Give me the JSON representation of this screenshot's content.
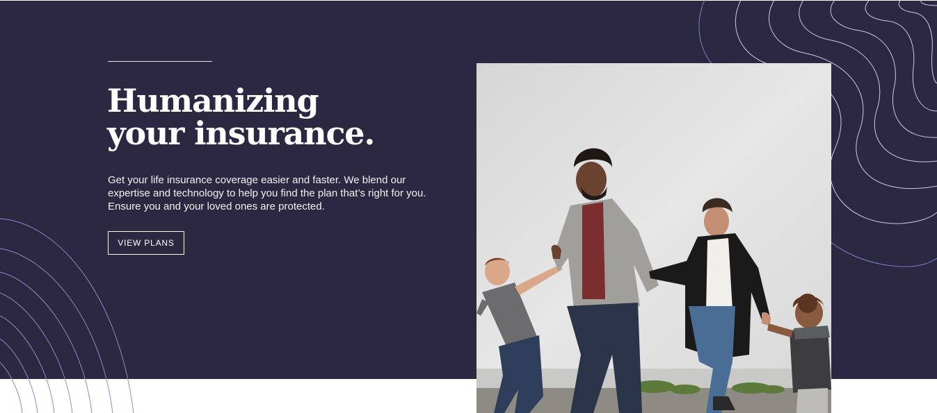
{
  "hero": {
    "headline_line1": "Humanizing",
    "headline_line2": "your insurance.",
    "description_line1": "Get your life insurance coverage easier and faster. We blend our",
    "description_line2": "expertise and technology to help you find the plan that’s right for you.",
    "description_line3": "Ensure you and your loved ones are protected.",
    "cta_label": "VIEW PLANS"
  },
  "photo": {
    "subject": "family-walking-holding-hands"
  },
  "colors": {
    "hero_background": "#2d2842",
    "page_background": "#ffffff",
    "text": "#ffffff",
    "contour_line": "#8f8ac8"
  }
}
